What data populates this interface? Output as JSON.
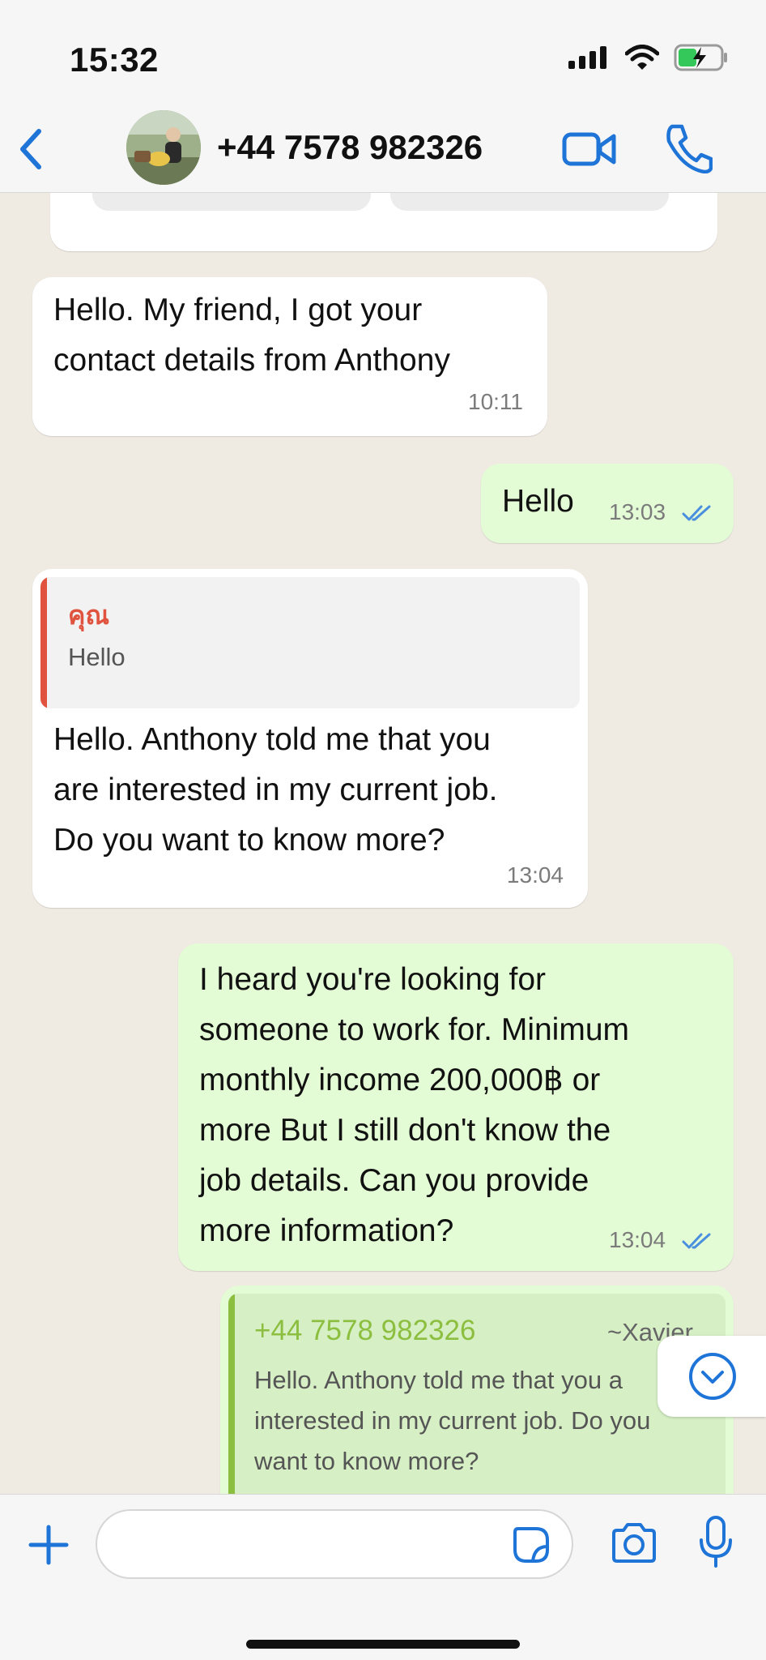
{
  "status_bar": {
    "time": "15:32"
  },
  "header": {
    "contact": "+44 7578 982326"
  },
  "messages": [
    {
      "dir": "in",
      "lines": [
        "Hello. My friend, I got your",
        "contact details from Anthony"
      ],
      "time": "10:11"
    },
    {
      "dir": "out",
      "lines": [
        "Hello"
      ],
      "time": "13:03",
      "read": true
    },
    {
      "dir": "in",
      "quote": {
        "name": "คุณ",
        "text": "Hello"
      },
      "lines": [
        "Hello. Anthony told me that you",
        "are interested in my current job.",
        "Do you want to know more?"
      ],
      "time": "13:04"
    },
    {
      "dir": "out",
      "lines": [
        "I heard you're looking for",
        "someone to work for. Minimum",
        "monthly income 200,000฿ or",
        "more But I still don't know the",
        "job details. Can you provide",
        "more information?"
      ],
      "time": "13:04",
      "read": true
    },
    {
      "dir": "out",
      "quote": {
        "name": "+44 7578 982326",
        "alias": "~Xavier",
        "lines": [
          "Hello. Anthony told me that you a",
          "interested in my current job. Do you",
          "want to know more?"
        ]
      }
    }
  ],
  "colors": {
    "accent_blue": "#1f74d8",
    "quote_red": "#e0533f",
    "quote_green": "#8cbf3f",
    "outgoing_bubble": "#e3fcd5",
    "chat_background": "#efeae2"
  },
  "icons": [
    "back-chevron-icon",
    "video-call-icon",
    "phone-icon",
    "plus-icon",
    "sticker-icon",
    "camera-icon",
    "microphone-icon",
    "chevron-down-icon",
    "read-ticks-icon"
  ]
}
